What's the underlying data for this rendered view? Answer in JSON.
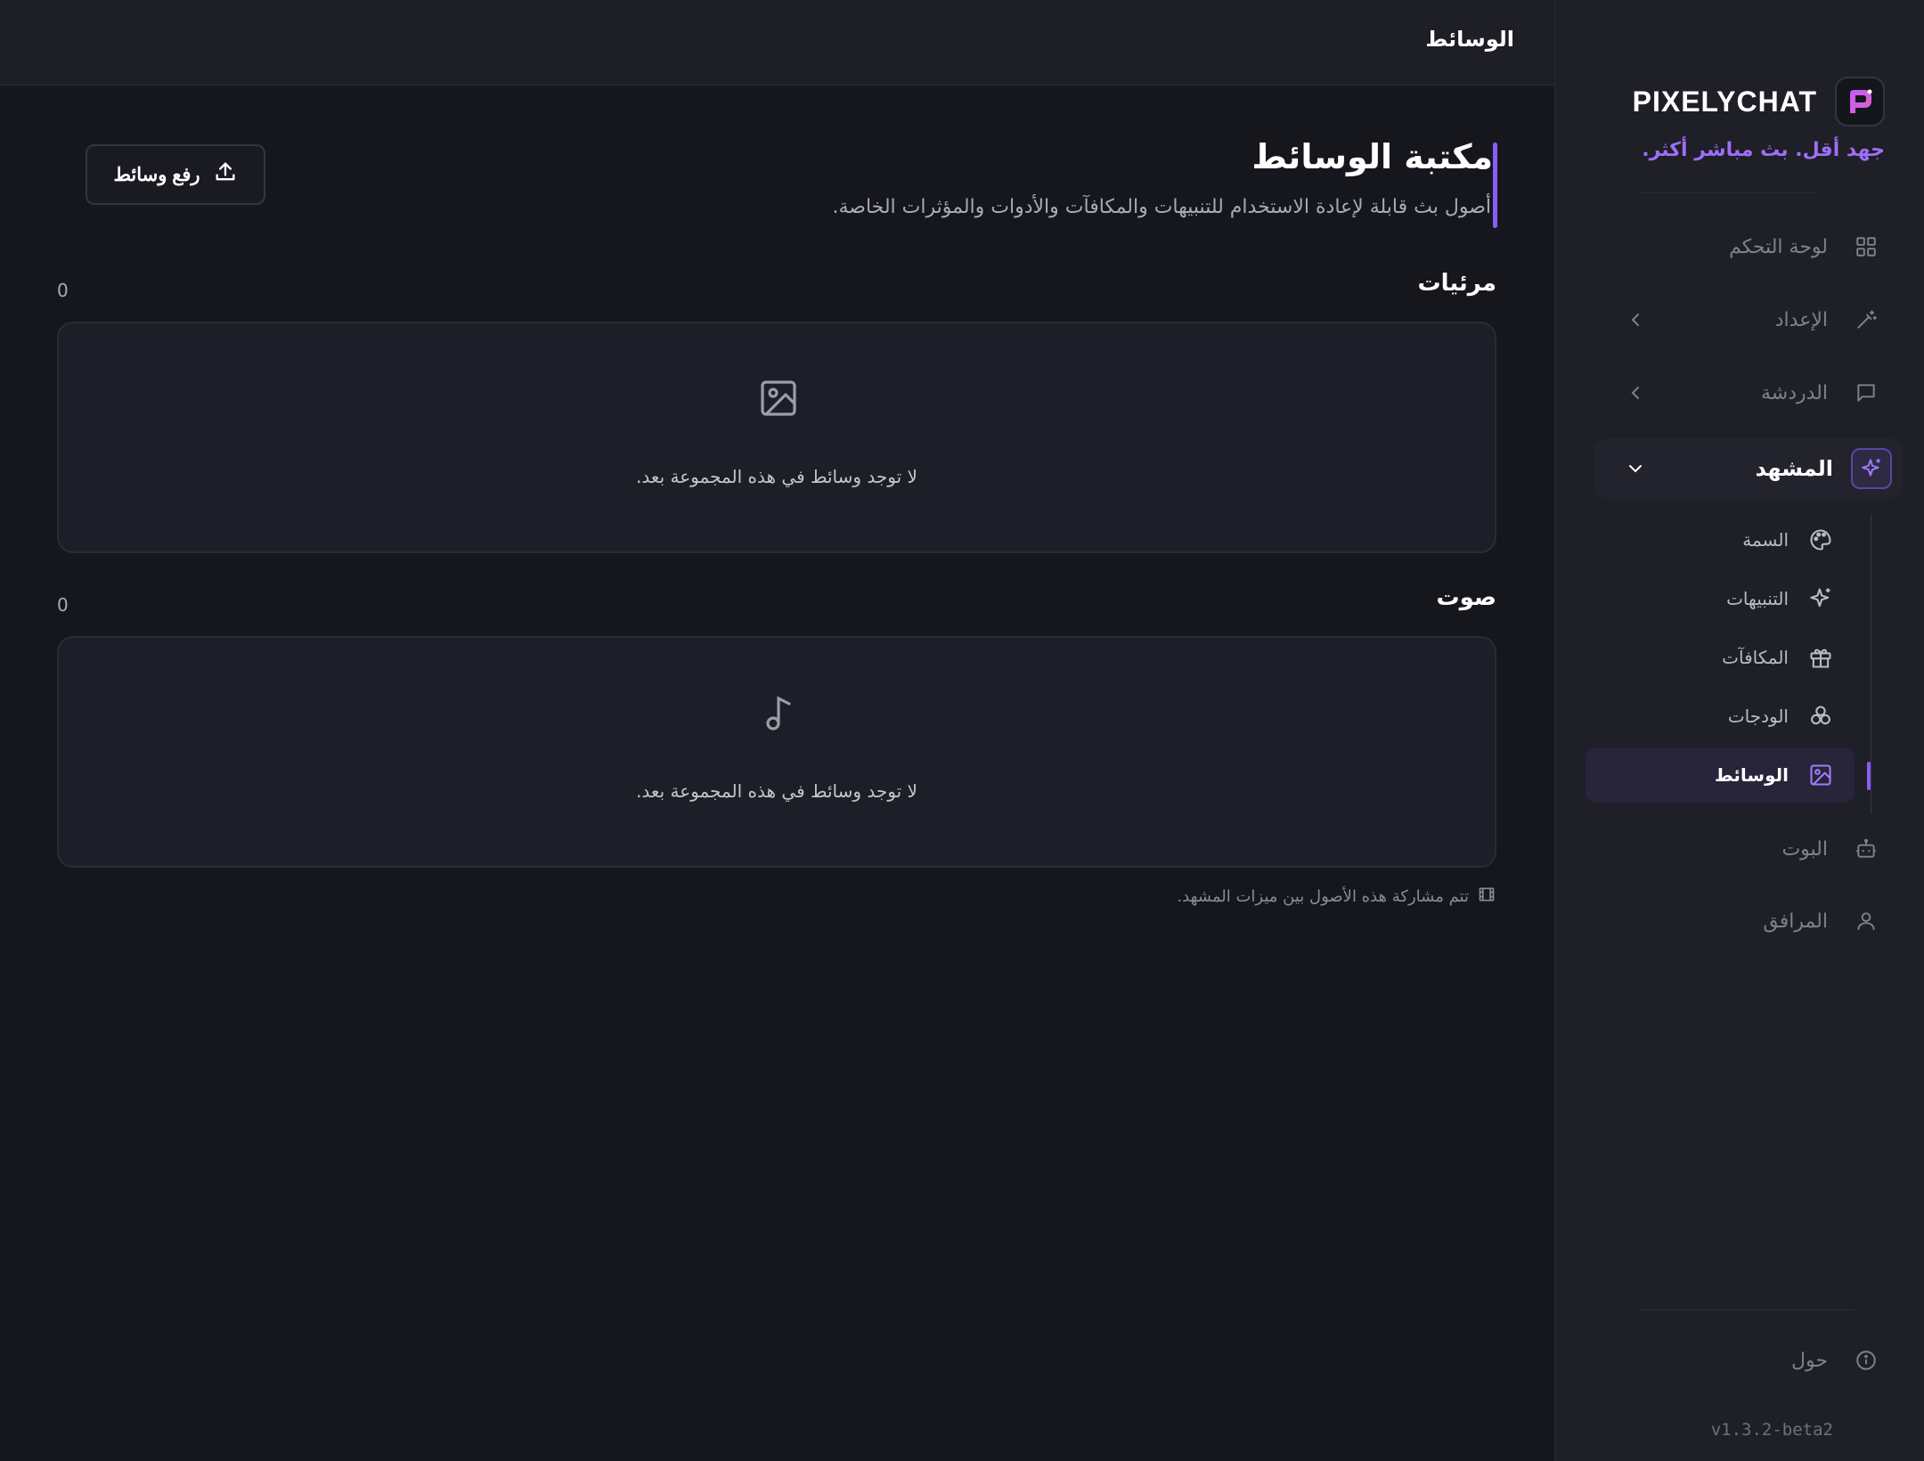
{
  "sidebar": {
    "brand": "PIXELYCHAT",
    "tagline": "جهد أقل. بث مباشر أكثر.",
    "nav": [
      {
        "label": "لوحة التحكم",
        "icon": "grid-icon"
      },
      {
        "label": "الإعداد",
        "icon": "wand-icon"
      },
      {
        "label": "الدردشة",
        "icon": "chat-icon"
      },
      {
        "label": "المشهد",
        "icon": "sparkles-icon"
      }
    ],
    "scene_items": [
      {
        "label": "السمة",
        "icon": "palette-icon"
      },
      {
        "label": "التنبيهات",
        "icon": "sparkles-icon"
      },
      {
        "label": "المكافآت",
        "icon": "gift-icon"
      },
      {
        "label": "الودجات",
        "icon": "shapes-icon"
      },
      {
        "label": "الوسائط",
        "icon": "image-icon"
      }
    ],
    "bottom_nav": [
      {
        "label": "البوت",
        "icon": "bot-icon"
      },
      {
        "label": "المرافق",
        "icon": "user-icon"
      }
    ],
    "about": {
      "label": "حول",
      "icon": "info-icon"
    },
    "version": "v1.3.2-beta2"
  },
  "topbar": {
    "title": "الوسائط"
  },
  "page": {
    "title": "مكتبة الوسائط",
    "subtitle": "أصول بث قابلة لإعادة الاستخدام للتنبيهات والمكافآت والأدوات والمؤثرات الخاصة.",
    "upload_label": "رفع وسائط"
  },
  "sections": [
    {
      "title": "مرئيات",
      "count": "0",
      "empty_text": "لا توجد وسائط في هذه المجموعة بعد.",
      "icon": "image-icon"
    },
    {
      "title": "صوت",
      "count": "0",
      "empty_text": "لا توجد وسائط في هذه المجموعة بعد.",
      "icon": "music-note-icon"
    }
  ],
  "footnote": "تتم مشاركة هذه الأصول بين ميزات المشهد.",
  "colors": {
    "accent": "#8b5cf6",
    "background": "#16171d",
    "sidebar": "#1e1f27"
  }
}
